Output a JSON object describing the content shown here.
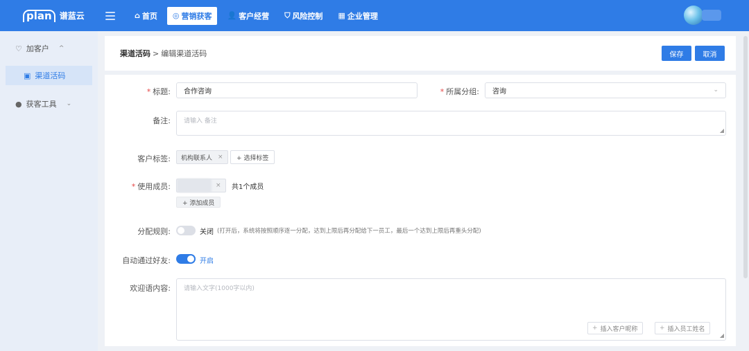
{
  "app": {
    "logo_mark": "plan",
    "name": "谱蓝云"
  },
  "nav": {
    "items": [
      {
        "label": "首页",
        "icon": "home-icon",
        "glyph": "⌂"
      },
      {
        "label": "营销获客",
        "icon": "target-icon",
        "glyph": "◎"
      },
      {
        "label": "客户经营",
        "icon": "user-icon",
        "glyph": "👤"
      },
      {
        "label": "风险控制",
        "icon": "shield-icon",
        "glyph": "⛉"
      },
      {
        "label": "企业管理",
        "icon": "building-icon",
        "glyph": "▦"
      }
    ],
    "active_index": 1
  },
  "sidebar": {
    "groups": [
      {
        "label": "加客户",
        "icon": "shield-heart-icon",
        "glyph": "♡",
        "chevron": "^"
      },
      {
        "label": "获客工具",
        "icon": "coin-icon",
        "glyph": "●",
        "chevron": "⌄"
      }
    ],
    "sub_item": {
      "label": "渠道活码",
      "icon": "qrcode-icon",
      "glyph": "▣"
    }
  },
  "header": {
    "breadcrumb_parent": "渠道活码",
    "breadcrumb_sep": ">",
    "breadcrumb_current": "编辑渠道活码",
    "save_label": "保存",
    "cancel_label": "取消"
  },
  "form": {
    "title_label": "标题:",
    "title_value": "合作咨询",
    "group_label": "所属分组:",
    "group_value": "咨询",
    "remark_label": "备注:",
    "remark_placeholder": "请输入 备注",
    "tags_label": "客户标签:",
    "tag_value": "机构联系人",
    "tag_close": "×",
    "select_tag_label": "+ 选择标签",
    "members_label": "使用成员:",
    "member_close": "×",
    "member_count": "共1个成员",
    "add_member_label": "+ 添加成员",
    "rule_label": "分配规则:",
    "rule_state": "关闭",
    "rule_hint": "(打开后，系统将按照顺序逐一分配，达到上限后再分配给下一员工，最后一个达到上限后再重头分配)",
    "auto_label": "自动通过好友:",
    "auto_state": "开启",
    "welcome_label": "欢迎语内容:",
    "welcome_placeholder": "请输入文字(1000字以内)",
    "insert_nickname": "插入客户昵称",
    "insert_staff": "插入员工姓名",
    "required_mark": "*"
  },
  "colors": {
    "primary": "#2f7ce6",
    "required": "#e54545"
  }
}
